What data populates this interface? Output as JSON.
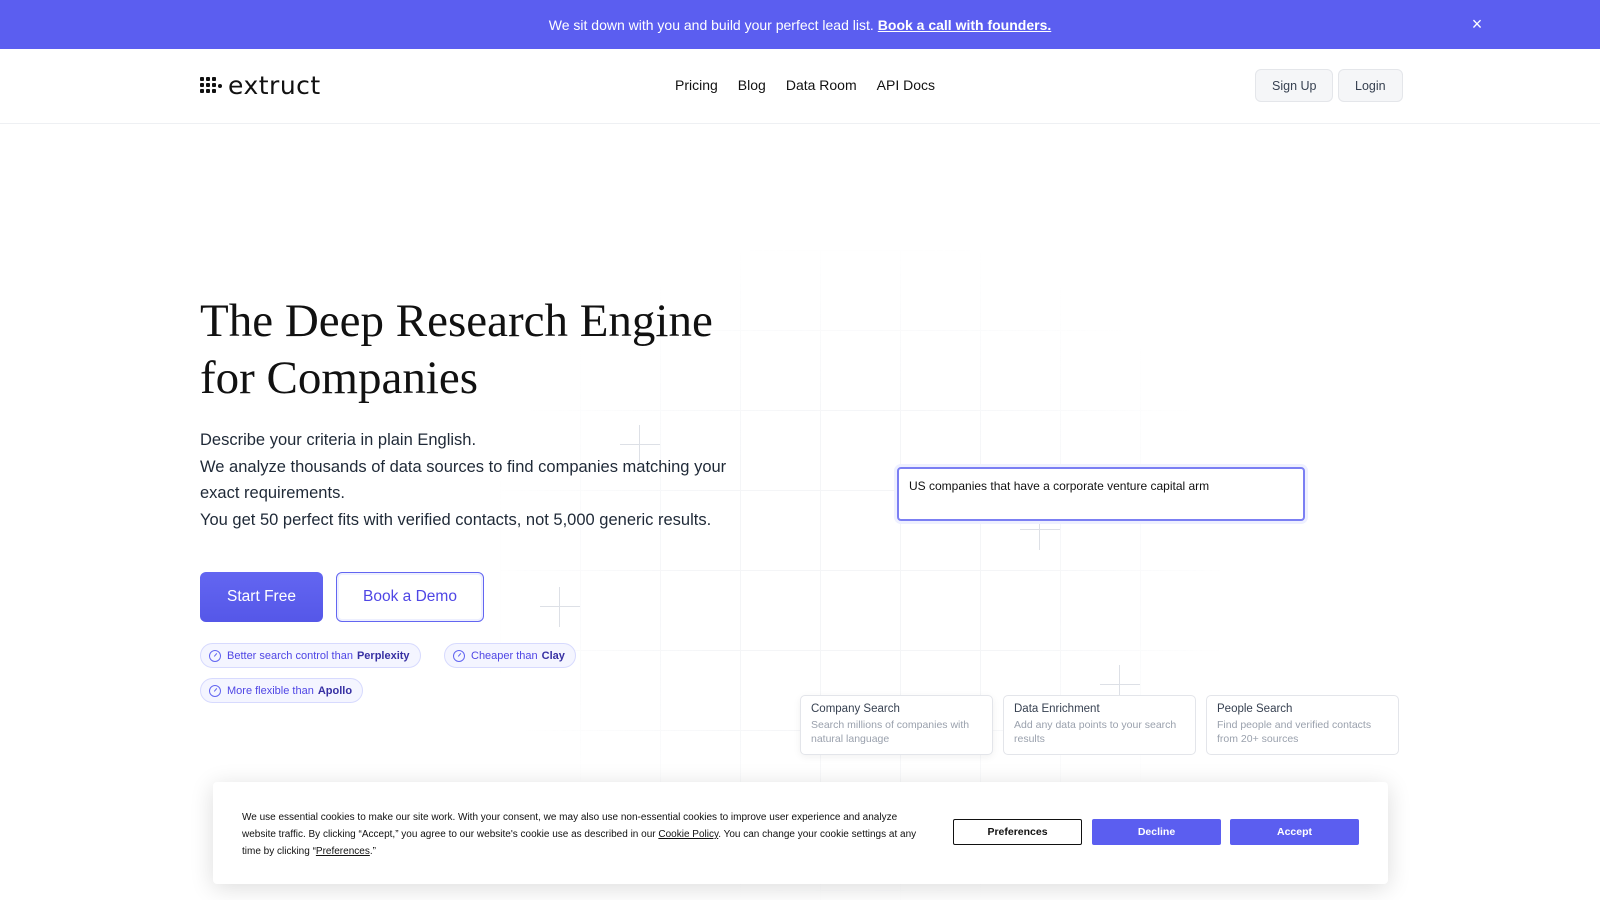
{
  "announcement": {
    "text": "We sit down with you and build your perfect lead list.",
    "link": "Book a call with founders.",
    "close_icon": "×"
  },
  "nav": {
    "logo_text": "extruct",
    "links": [
      "Pricing",
      "Blog",
      "Data Room",
      "API Docs"
    ],
    "signup": "Sign Up",
    "login": "Login"
  },
  "hero": {
    "title_line1": "The Deep Research Engine",
    "title_line2": "for Companies",
    "desc_line1": "Describe your criteria in plain English.",
    "desc_line2": "We analyze thousands of data sources to find companies matching your exact requirements.",
    "desc_line3": "You get 50 perfect fits with verified contacts, not 5,000 generic results.",
    "cta_primary": "Start Free",
    "cta_secondary": "Book a Demo"
  },
  "chips": [
    {
      "text": "Better search control than",
      "brand": "Perplexity"
    },
    {
      "text": "Cheaper than",
      "brand": "Clay"
    },
    {
      "text": "More flexible than",
      "brand": "Apollo"
    }
  ],
  "demo": {
    "query": "US companies that have a corporate venture capital arm"
  },
  "features": [
    {
      "title": "Company Search",
      "desc": "Search millions of companies with natural language"
    },
    {
      "title": "Data Enrichment",
      "desc": "Add any data points to your search results"
    },
    {
      "title": "People Search",
      "desc": "Find people and verified contacts from 20+ sources"
    }
  ],
  "cookie": {
    "text_before": "We use essential cookies to make our site work. With your consent, we may also use non-essential cookies to improve user experience and analyze website traffic. By clicking “Accept,” you agree to our website's cookie use as described in our",
    "policy_link": "Cookie Policy",
    "text_middle": ". You can change your cookie settings at any time by clicking “",
    "pref_link": "Preferences",
    "text_end": ".”",
    "preferences": "Preferences",
    "decline": "Decline",
    "accept": "Accept"
  },
  "colors": {
    "accent": "#5b5ef0",
    "accent_dark": "#4f46e5"
  }
}
